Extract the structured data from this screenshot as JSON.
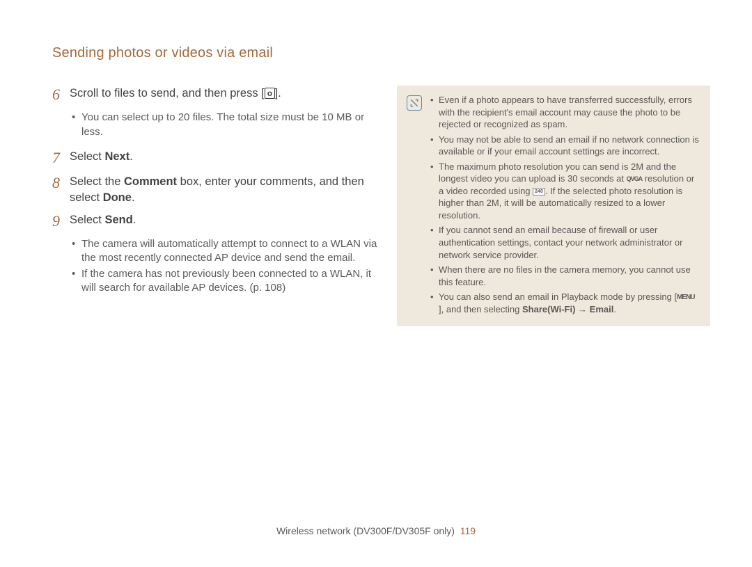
{
  "header": {
    "title": "Sending photos or videos via email"
  },
  "steps": {
    "s6": {
      "num": "6",
      "text_a": "Scroll to files to send, and then press [",
      "ok": "o",
      "text_b": "].",
      "sub1": "You can select up to 20 files. The total size must be 10 MB or less."
    },
    "s7": {
      "num": "7",
      "text_a": "Select ",
      "next": "Next",
      "text_b": "."
    },
    "s8": {
      "num": "8",
      "text_a": "Select the ",
      "comment": "Comment",
      "text_b": " box, enter your comments, and then select ",
      "done": "Done",
      "text_c": "."
    },
    "s9": {
      "num": "9",
      "text_a": "Select ",
      "send": "Send",
      "text_b": ".",
      "sub1": "The camera will automatically attempt to connect to a WLAN via the most recently connected AP device and send the email.",
      "sub2": "If the camera has not previously been connected to a WLAN, it will search for available AP devices. (p. 108)"
    }
  },
  "notes": {
    "n1": "Even if a photo appears to have transferred successfully, errors with the recipient's email account may cause the photo to be rejected or recognized as spam.",
    "n2": "You may not be able to send an email if no network connection is available or if your email account settings are incorrect.",
    "n3_a": "The maximum photo resolution you can send is 2M and the longest video you can upload is 30 seconds at ",
    "n3_qvga": "QVGA",
    "n3_b": " resolution or a video recorded using ",
    "n3_240": "240",
    "n3_c": ". If the selected photo resolution is higher than 2M, it will be automatically resized to a lower resolution.",
    "n4": "If you cannot send an email because of firewall or user authentication settings, contact your network administrator or network service provider.",
    "n5": "When there are no files in the camera memory, you cannot use this feature.",
    "n6_a": "You can also send an email in Playback mode by pressing [",
    "n6_menu": "MENU",
    "n6_b": "], and then selecting ",
    "n6_share": "Share(Wi-Fi)",
    "n6_arrow": " → ",
    "n6_email": "Email",
    "n6_c": "."
  },
  "footer": {
    "text": "Wireless network (DV300F/DV305F only)",
    "page": "119"
  }
}
